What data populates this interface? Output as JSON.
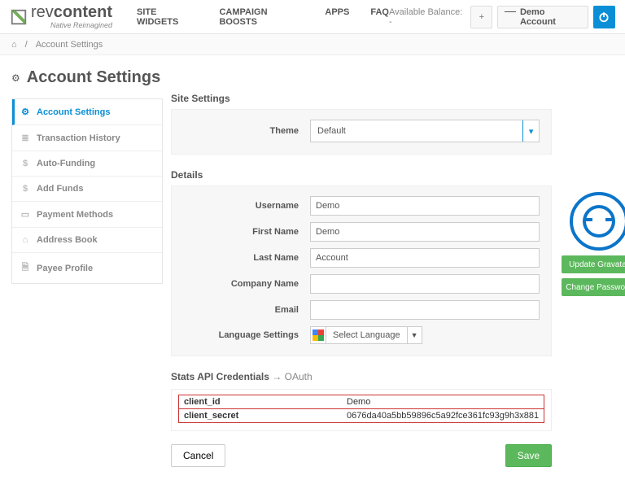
{
  "logo": {
    "line1a": "rev",
    "line1b": "content",
    "sub": "Native Reimagined"
  },
  "nav": [
    "SITE WIDGETS",
    "CAMPAIGN BOOSTS",
    "APPS",
    "FAQ"
  ],
  "top": {
    "balance": "Available Balance: -",
    "demo": "Demo Account"
  },
  "breadcrumb": {
    "page": "Account Settings"
  },
  "title": "Account Settings",
  "sidebar": [
    {
      "icon": "⚙",
      "label": "Account Settings"
    },
    {
      "icon": "≣",
      "label": "Transaction History"
    },
    {
      "icon": "$",
      "label": "Auto-Funding"
    },
    {
      "icon": "$",
      "label": "Add Funds"
    },
    {
      "icon": "▭",
      "label": "Payment Methods"
    },
    {
      "icon": "⌂",
      "label": "Address Book"
    },
    {
      "icon": "🗎",
      "label": "Payee Profile"
    }
  ],
  "section1": {
    "title": "Site Settings",
    "theme_label": "Theme",
    "theme_value": "Default"
  },
  "section2": {
    "title": "Details",
    "username_label": "Username",
    "username": "Demo",
    "firstname_label": "First Name",
    "firstname": "Demo",
    "lastname_label": "Last Name",
    "lastname": "Account",
    "company_label": "Company Name",
    "company": "",
    "email_label": "Email",
    "email": "",
    "lang_label": "Language Settings",
    "lang_value": "Select Language"
  },
  "api": {
    "title": "Stats API Credentials",
    "sub": "→ OAuth",
    "id_label": "client_id",
    "id_value": "Demo",
    "secret_label": "client_secret",
    "secret_value": "0676da40a5bb59896c5a92fce361fc93g9h3x881"
  },
  "buttons": {
    "cancel": "Cancel",
    "save": "Save"
  },
  "right": {
    "update": "Update Gravatar",
    "change": "Change Password"
  }
}
